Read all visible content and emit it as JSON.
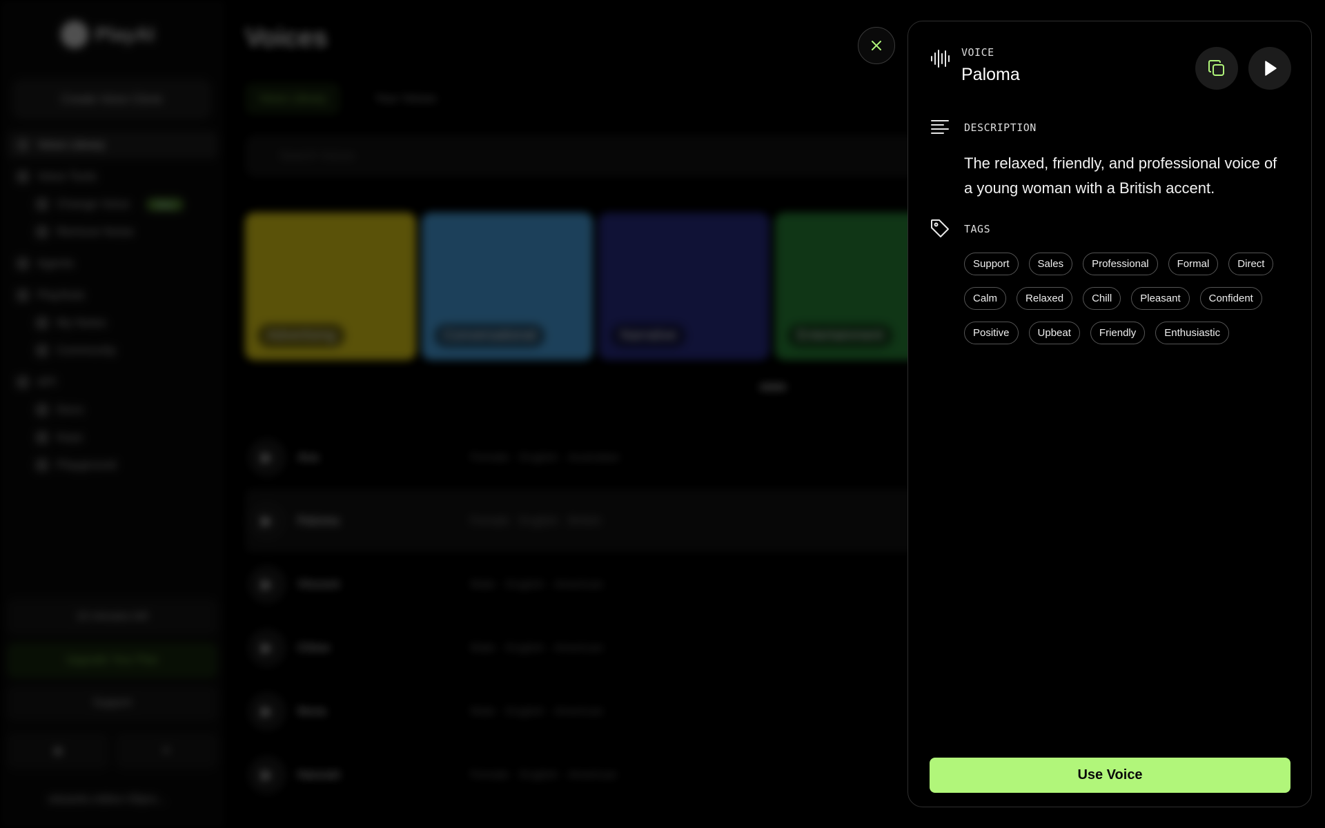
{
  "background": {
    "logo": "PlayAI",
    "create_button": "Create Voice Clone",
    "nav": [
      {
        "label": "Voice Library",
        "type": "item",
        "active": true
      },
      {
        "label": "Voice Tools",
        "type": "item"
      },
      {
        "label": "Change Voice",
        "type": "sub",
        "badge": "New"
      },
      {
        "label": "Remove Noise",
        "type": "sub"
      },
      {
        "label": "Agents",
        "type": "item"
      },
      {
        "label": "PlayNote",
        "type": "item"
      },
      {
        "label": "My Notes",
        "type": "sub"
      },
      {
        "label": "Community",
        "type": "sub"
      },
      {
        "label": "API",
        "type": "item"
      },
      {
        "label": "Docs",
        "type": "sub"
      },
      {
        "label": "Keys",
        "type": "sub"
      },
      {
        "label": "Playground",
        "type": "sub"
      }
    ],
    "minutes_left": "10 minutes left",
    "upgrade": "Upgrade Your Plan",
    "support": "Support",
    "user": "eduardo.robles+30pro...",
    "main_title": "Voices",
    "tabs": [
      "Voice Library",
      "Your Voices"
    ],
    "search_placeholder": "Search Voices",
    "cards": [
      {
        "label": "Advertising",
        "color": "#e6d21a"
      },
      {
        "label": "Conversational",
        "color": "#4aa6e6"
      },
      {
        "label": "Narrative",
        "color": "#2a2f8a"
      },
      {
        "label": "Entertainment",
        "color": "#2a8a3a"
      }
    ],
    "rows": [
      {
        "name": "Ava",
        "meta": "Female  ·  English  ·  Australian"
      },
      {
        "name": "Paloma",
        "meta": "Female  ·  English  ·  British"
      },
      {
        "name": "Vincent",
        "meta": "Male  ·  English  ·  American"
      },
      {
        "name": "Chloe",
        "meta": "Male  ·  English  ·  American"
      },
      {
        "name": "Nova",
        "meta": "Male  ·  English  ·  American"
      },
      {
        "name": "Hannah",
        "meta": "Female  ·  English  ·  American"
      }
    ]
  },
  "panel": {
    "voice_label": "VOICE",
    "voice_name": "Paloma",
    "description_label": "DESCRIPTION",
    "description": "The relaxed, friendly, and professional voice of a young woman with a British accent.",
    "tags_label": "TAGS",
    "tags": [
      "Support",
      "Sales",
      "Professional",
      "Formal",
      "Direct",
      "Calm",
      "Relaxed",
      "Chill",
      "Pleasant",
      "Confident",
      "Positive",
      "Upbeat",
      "Friendly",
      "Enthusiastic"
    ],
    "use_voice_label": "Use Voice",
    "accent_color": "#b1f67a",
    "icons": {
      "voice": "waveform-icon",
      "copy": "copy-icon",
      "play": "play-icon",
      "description": "text-lines-icon",
      "tags": "tag-icon",
      "close": "close-icon"
    }
  }
}
